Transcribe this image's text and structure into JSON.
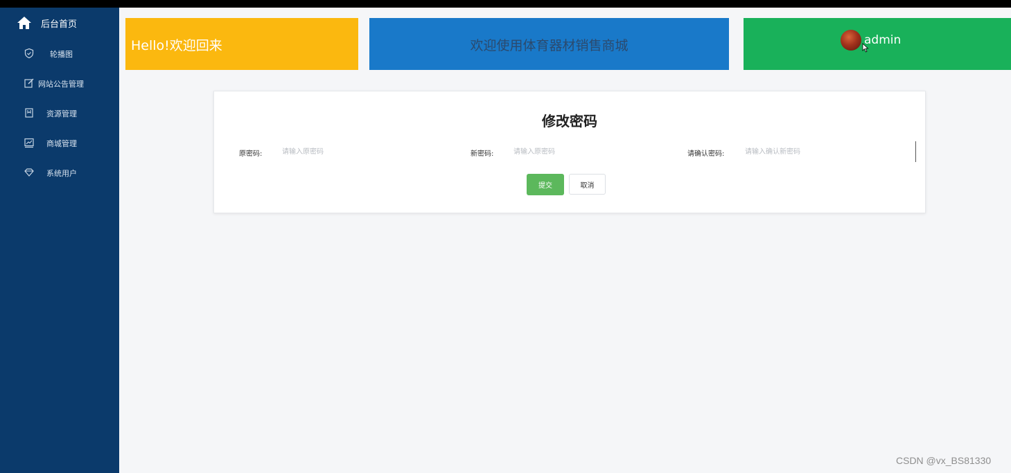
{
  "sidebar": {
    "home": {
      "label": "后台首页",
      "icon": "home-icon"
    },
    "items": [
      {
        "label": "轮播图",
        "icon": "shield-icon"
      },
      {
        "label": "网站公告管理",
        "icon": "edit-icon"
      },
      {
        "label": "资源管理",
        "icon": "bookmark-icon"
      },
      {
        "label": "商城管理",
        "icon": "chart-icon"
      },
      {
        "label": "系统用户",
        "icon": "diamond-icon"
      }
    ]
  },
  "header": {
    "welcome": "Hello!欢迎回来",
    "site_title": "欢迎使用体育器材销售商城",
    "username": "admin"
  },
  "form": {
    "title": "修改密码",
    "old_password": {
      "label": "原密码:",
      "placeholder": "请输入原密码"
    },
    "new_password": {
      "label": "新密码:",
      "placeholder": "请输入原密码"
    },
    "confirm_password": {
      "label": "请确认密码:",
      "placeholder": "请输入确认新密码"
    },
    "submit_label": "提交",
    "cancel_label": "取消"
  },
  "watermark": "CSDN @vx_BS81330",
  "colors": {
    "sidebar_bg": "#0b3a6b",
    "card_yellow": "#fbb80f",
    "card_blue": "#1979c9",
    "card_green": "#19b15a",
    "submit_green": "#5cb85c"
  }
}
